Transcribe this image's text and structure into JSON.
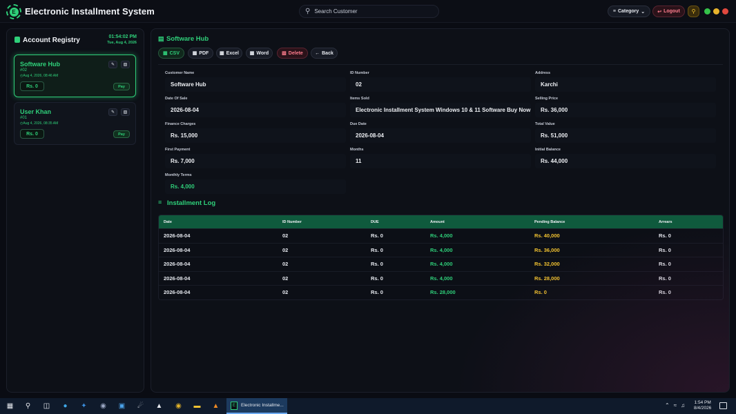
{
  "app": {
    "title": "Electronic Installment System",
    "logo_letter": "E"
  },
  "search": {
    "placeholder": "Search Customer",
    "value": ""
  },
  "header": {
    "category_label": "Category",
    "logout_label": "Logout"
  },
  "registry": {
    "title": "Account Registry",
    "time": "01:54:02 PM",
    "date": "Tue, Aug 4, 2026",
    "accounts": [
      {
        "name": "Software Hub",
        "id": "#02",
        "date": "Aug 4, 2026, 08:46 AM",
        "balance": "Rs. 0",
        "pay_label": "Pay",
        "active": true
      },
      {
        "name": "User Khan",
        "id": "#01",
        "date": "Aug 4, 2026, 08:35 AM",
        "balance": "Rs. 0",
        "pay_label": "Pay",
        "active": false
      }
    ]
  },
  "detail": {
    "title": "Software Hub",
    "toolbar": {
      "csv": "CSV",
      "pdf": "PDF",
      "excel": "Excel",
      "word": "Word",
      "delete": "Delete",
      "back": "Back"
    },
    "fields": {
      "customer_name": {
        "label": "Customer Name",
        "value": "Software Hub"
      },
      "id_number": {
        "label": "ID Number",
        "value": "02"
      },
      "address": {
        "label": "Address",
        "value": "Karchi"
      },
      "date_of_sale": {
        "label": "Date Of Sale",
        "value": "2026-08-04"
      },
      "items_sold": {
        "label": "Items Sold",
        "value": "Electronic Installment System Windows 10 & 11 Software Buy Now"
      },
      "selling_price": {
        "label": "Selling Price",
        "value": "Rs. 36,000"
      },
      "finance_charges": {
        "label": "Finance Charges",
        "value": "Rs. 15,000"
      },
      "due_date": {
        "label": "Due Date",
        "value": "2026-08-04"
      },
      "total_value": {
        "label": "Total Value",
        "value": "Rs. 51,000"
      },
      "first_payment": {
        "label": "First Payment",
        "value": "Rs. 7,000"
      },
      "months": {
        "label": "Months",
        "value": "11"
      },
      "initial_balance": {
        "label": "Initial Balance",
        "value": "Rs. 44,000"
      },
      "monthly_terms": {
        "label": "Monthly Terms",
        "value": "Rs. 4,000"
      }
    }
  },
  "log": {
    "title": "Installment Log",
    "columns": [
      "Date",
      "ID Number",
      "DUE",
      "Amount",
      "Pending Balance",
      "Arrears"
    ],
    "rows": [
      [
        "2026-08-04",
        "02",
        "Rs. 0",
        "Rs. 4,000",
        "Rs. 40,000",
        "Rs. 0"
      ],
      [
        "2026-08-04",
        "02",
        "Rs. 0",
        "Rs. 4,000",
        "Rs. 36,000",
        "Rs. 0"
      ],
      [
        "2026-08-04",
        "02",
        "Rs. 0",
        "Rs. 4,000",
        "Rs. 32,000",
        "Rs. 0"
      ],
      [
        "2026-08-04",
        "02",
        "Rs. 0",
        "Rs. 4,000",
        "Rs. 28,000",
        "Rs. 0"
      ],
      [
        "2026-08-04",
        "02",
        "Rs. 0",
        "Rs. 28,000",
        "Rs. 0",
        "Rs. 0"
      ]
    ]
  },
  "taskbar": {
    "active_app": "Electronic Installme...",
    "time": "1:54 PM",
    "date": "8/4/2026"
  },
  "colors": {
    "accent": "#2fd07a",
    "pending": "#f4c430",
    "danger": "#ff7d8e",
    "table_header": "#0f5a3d"
  }
}
